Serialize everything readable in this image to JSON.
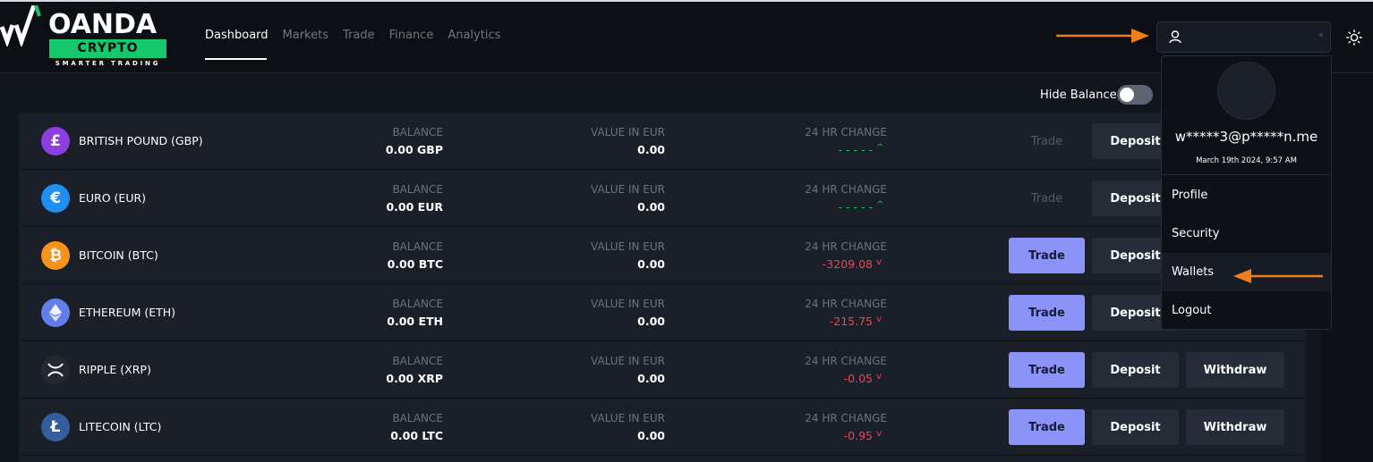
{
  "app": {
    "logo_word": "OANDA",
    "logo_sub": "CRYPTO",
    "logo_tagline": "SMARTER TRADING"
  },
  "nav": {
    "items": [
      "Dashboard",
      "Markets",
      "Trade",
      "Finance",
      "Analytics"
    ],
    "active": "Dashboard"
  },
  "hide_balance": {
    "label": "Hide Balance",
    "enabled": false
  },
  "user_menu": {
    "email": "w*****3@p*****n.me",
    "date": "March 19th 2024, 9:57 AM",
    "items": [
      "Profile",
      "Security",
      "Wallets",
      "Logout"
    ],
    "highlighted": "Wallets"
  },
  "columns": {
    "balance": "BALANCE",
    "value": "VALUE IN EUR",
    "change": "24 HR CHANGE"
  },
  "buttons": {
    "trade": "Trade",
    "deposit": "Deposit",
    "withdraw": "Withdraw"
  },
  "wallets": [
    {
      "name": "BRITISH POUND (GBP)",
      "icon": "pound-icon",
      "balance": "0.00 GBP",
      "value": "0.00",
      "change": "- - - - -",
      "direction": "up",
      "trade_enabled": false
    },
    {
      "name": "EURO (EUR)",
      "icon": "euro-icon",
      "balance": "0.00 EUR",
      "value": "0.00",
      "change": "- - - - -",
      "direction": "up",
      "trade_enabled": false
    },
    {
      "name": "BITCOIN (BTC)",
      "icon": "bitcoin-icon",
      "balance": "0.00 BTC",
      "value": "0.00",
      "change": "-3209.08",
      "direction": "down",
      "trade_enabled": true
    },
    {
      "name": "ETHEREUM (ETH)",
      "icon": "ethereum-icon",
      "balance": "0.00 ETH",
      "value": "0.00",
      "change": "-215.75",
      "direction": "down",
      "trade_enabled": true
    },
    {
      "name": "RIPPLE (XRP)",
      "icon": "ripple-icon",
      "balance": "0.00 XRP",
      "value": "0.00",
      "change": "-0.05",
      "direction": "down",
      "trade_enabled": true
    },
    {
      "name": "LITECOIN (LTC)",
      "icon": "litecoin-icon",
      "balance": "0.00 LTC",
      "value": "0.00",
      "change": "-0.95",
      "direction": "down",
      "trade_enabled": true
    }
  ],
  "colors": {
    "accent_green": "#14c86b",
    "trade_button": "#8b93f8",
    "negative": "#f0435a",
    "annotation_arrow": "#f07f1a"
  }
}
